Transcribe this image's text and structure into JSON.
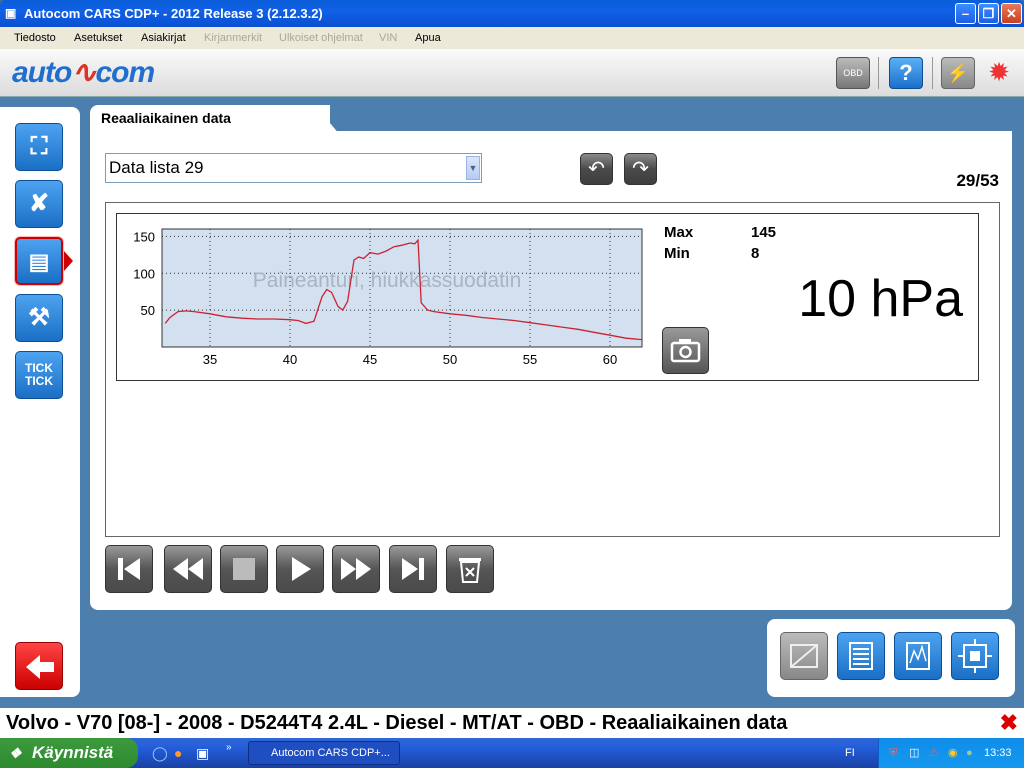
{
  "window": {
    "title": "Autocom CARS CDP+ - 2012 Release 3 (2.12.3.2)"
  },
  "menu": {
    "items": [
      {
        "label": "Tiedosto",
        "enabled": true
      },
      {
        "label": "Asetukset",
        "enabled": true
      },
      {
        "label": "Asiakirjat",
        "enabled": true
      },
      {
        "label": "Kirjanmerkit",
        "enabled": false
      },
      {
        "label": "Ulkoiset ohjelmat",
        "enabled": false
      },
      {
        "label": "VIN",
        "enabled": false
      },
      {
        "label": "Apua",
        "enabled": true
      }
    ]
  },
  "header": {
    "logo_part1": "auto",
    "logo_part2": "com",
    "obd_badge": "OBD"
  },
  "tab": {
    "title": "Reaaliaikainen data"
  },
  "selector": {
    "value": "Data lista 29"
  },
  "pager": {
    "text": "29/53"
  },
  "readout": {
    "max_label": "Max",
    "max_value": "145",
    "min_label": "Min",
    "min_value": "8",
    "current": "10 hPa"
  },
  "nav": {
    "tick_label_1": "TICK",
    "tick_label_2": "TICK"
  },
  "status": {
    "text": "Volvo - V70 [08-] - 2008 - D5244T4 2.4L - Diesel - MT/AT - OBD - Reaaliaikainen data"
  },
  "taskbar": {
    "start": "Käynnistä",
    "task": "Autocom CARS CDP+...",
    "lang": "FI",
    "clock": "13:33"
  },
  "chart_data": {
    "type": "line",
    "title": "Paineanturi, hiukkassuodatin",
    "xlim": [
      32,
      62
    ],
    "ylim": [
      0,
      160
    ],
    "xticks": [
      35,
      40,
      45,
      50,
      55,
      60
    ],
    "yticks": [
      50,
      100,
      150
    ],
    "grid": true,
    "color": "#cc2233",
    "series": [
      {
        "x": [
          32.2,
          32.5,
          33,
          33.5,
          34,
          35,
          36,
          37,
          38,
          39,
          40,
          40.5,
          41,
          41.5,
          42,
          42.3,
          42.6,
          43,
          43.3,
          43.6,
          44,
          44.3,
          44.6,
          45,
          45.5,
          46,
          46.5,
          47,
          47.5,
          47.8,
          48,
          48.2,
          48.6,
          49,
          50,
          51,
          52,
          53,
          54,
          55,
          56,
          57,
          58,
          59,
          60,
          61,
          62
        ],
        "y": [
          32,
          40,
          48,
          49,
          48,
          45,
          41,
          39,
          38,
          38,
          37,
          36,
          32,
          35,
          68,
          78,
          74,
          55,
          50,
          62,
          118,
          122,
          120,
          128,
          126,
          130,
          136,
          138,
          141,
          140,
          145,
          60,
          50,
          48,
          45,
          43,
          40,
          38,
          36,
          33,
          30,
          27,
          24,
          20,
          16,
          12,
          10
        ]
      }
    ]
  }
}
